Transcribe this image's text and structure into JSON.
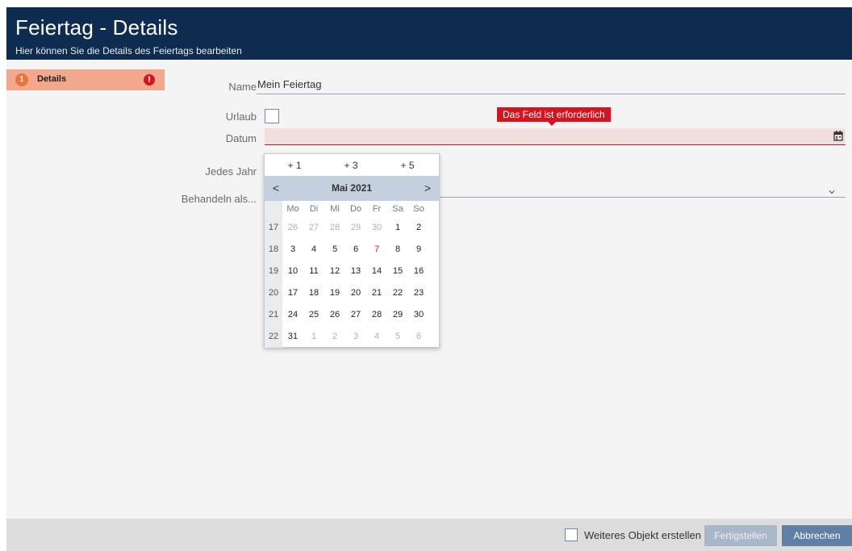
{
  "header": {
    "title": "Feiertag - Details",
    "subtitle": "Hier können Sie die Details des Feiertags bearbeiten"
  },
  "sidebar": {
    "steps": [
      {
        "number": "1",
        "label": "Details",
        "error_badge": "!"
      }
    ]
  },
  "form": {
    "name": {
      "label": "Name",
      "value": "Mein Feiertag"
    },
    "urlaub": {
      "label": "Urlaub",
      "checked": false
    },
    "datum": {
      "label": "Datum",
      "value": "",
      "error": "Das Feld ist erforderlich",
      "icon": "calendar-icon"
    },
    "jedes_jahr": {
      "label": "Jedes Jahr"
    },
    "behandeln_als": {
      "label": "Behandeln als...",
      "value": ""
    }
  },
  "calendar": {
    "quick": [
      "+ 1",
      "+ 3",
      "+ 5"
    ],
    "prev": "<",
    "next": ">",
    "month_label": "Mai 2021",
    "weekdays": [
      "Mo",
      "Di",
      "Mi",
      "Do",
      "Fr",
      "Sa",
      "So"
    ],
    "today": "7",
    "weeks": [
      {
        "wk": "17",
        "days": [
          "26",
          "27",
          "28",
          "29",
          "30",
          "1",
          "2"
        ],
        "other": [
          true,
          true,
          true,
          true,
          true,
          false,
          false
        ]
      },
      {
        "wk": "18",
        "days": [
          "3",
          "4",
          "5",
          "6",
          "7",
          "8",
          "9"
        ],
        "other": [
          false,
          false,
          false,
          false,
          false,
          false,
          false
        ]
      },
      {
        "wk": "19",
        "days": [
          "10",
          "11",
          "12",
          "13",
          "14",
          "15",
          "16"
        ],
        "other": [
          false,
          false,
          false,
          false,
          false,
          false,
          false
        ]
      },
      {
        "wk": "20",
        "days": [
          "17",
          "18",
          "19",
          "20",
          "21",
          "22",
          "23"
        ],
        "other": [
          false,
          false,
          false,
          false,
          false,
          false,
          false
        ]
      },
      {
        "wk": "21",
        "days": [
          "24",
          "25",
          "26",
          "27",
          "28",
          "29",
          "30"
        ],
        "other": [
          false,
          false,
          false,
          false,
          false,
          false,
          false
        ]
      },
      {
        "wk": "22",
        "days": [
          "31",
          "1",
          "2",
          "3",
          "4",
          "5",
          "6"
        ],
        "other": [
          false,
          true,
          true,
          true,
          true,
          true,
          true
        ]
      }
    ]
  },
  "footer": {
    "another_label": "Weiteres Objekt erstellen",
    "finish_label": "Fertigstellen",
    "cancel_label": "Abbrechen"
  },
  "colors": {
    "header_bg": "#0d2c4f",
    "step_bg": "#f2a88c",
    "error": "#d4141e",
    "calendar_nav": "#c5d0de",
    "button_primary": "#5f7fa5"
  }
}
